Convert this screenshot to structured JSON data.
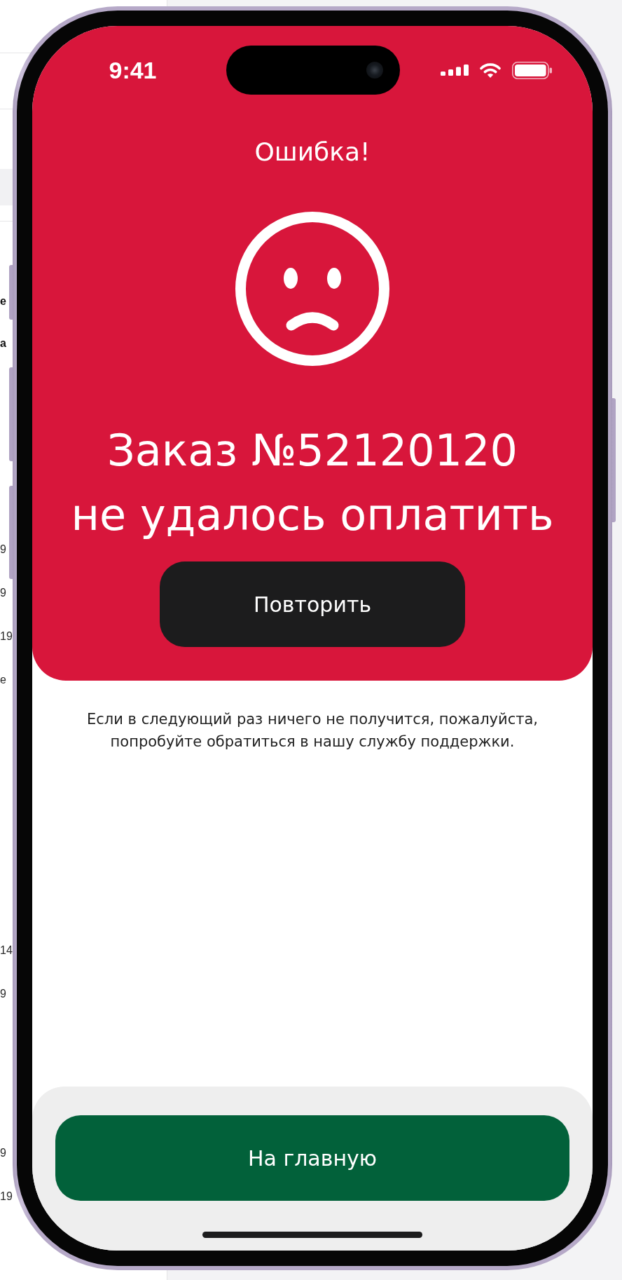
{
  "background_page": {
    "groups": [
      {
        "rows": [
          {
            "kind": "label",
            "text": "е"
          },
          {
            "kind": "label",
            "text": "а"
          }
        ]
      },
      {
        "rows": [
          {
            "kind": "value",
            "text": "9"
          },
          {
            "kind": "value",
            "text": "9"
          },
          {
            "kind": "value",
            "text": "19"
          },
          {
            "kind": "value",
            "text": "е"
          }
        ]
      },
      {
        "rows": [
          {
            "kind": "value",
            "text": "14"
          },
          {
            "kind": "value",
            "text": "9"
          }
        ]
      },
      {
        "rows": [
          {
            "kind": "value",
            "text": "9"
          },
          {
            "kind": "value",
            "text": "19"
          }
        ]
      }
    ]
  },
  "status_bar": {
    "time": "9:41"
  },
  "error_panel": {
    "title": "Ошибка!",
    "message": "Заказ №52120120\nне удалось оплатить",
    "retry_button": "Повторить"
  },
  "help_text": "Если в следующий раз ничего не получится, пожалуйста, попробуйте обратиться в нашу службу поддержки.",
  "bottom_bar": {
    "home_button": "На главную"
  }
}
